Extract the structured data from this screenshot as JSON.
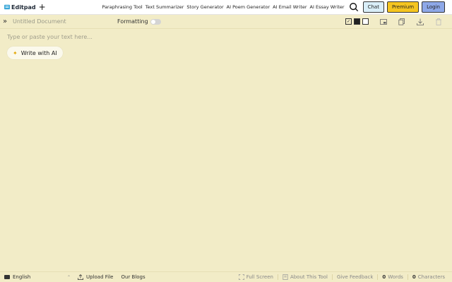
{
  "header": {
    "logo_text": "Editpad",
    "nav_links": [
      "Paraphrasing Tool",
      "Text Summarizer",
      "Story Generator",
      "AI Poem Generator",
      "AI Email Writer",
      "AI Essay Writer"
    ],
    "chat_label": "Chat",
    "premium_label": "Premium",
    "login_label": "Login"
  },
  "toolbar": {
    "doc_title_placeholder": "Untitled Document",
    "formatting_label": "Formatting"
  },
  "editor": {
    "placeholder": "Type or paste your text here...",
    "write_ai_label": "Write with AI"
  },
  "footer": {
    "language": "English",
    "upload_label": "Upload File",
    "blogs_label": "Our Blogs",
    "fullscreen_label": "Full Screen",
    "about_label": "About This Tool",
    "feedback_label": "Give Feedback",
    "words_count": "0",
    "words_label": "Words",
    "chars_count": "0",
    "chars_label": "Characters"
  },
  "colors": {
    "editor_bg": "#f2ecc7",
    "premium": "#f5c520",
    "login": "#8ea8e8",
    "chat": "#d9eef8"
  }
}
